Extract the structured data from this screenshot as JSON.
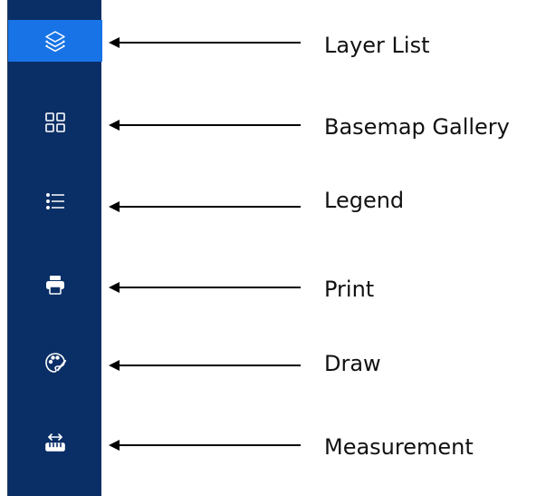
{
  "toolbar": {
    "accent_color": "#1874e6",
    "background_color": "#0a2f66",
    "tools": [
      {
        "icon": "layers-icon",
        "active": true
      },
      {
        "icon": "grid-icon",
        "active": false
      },
      {
        "icon": "list-icon",
        "active": false
      },
      {
        "icon": "printer-icon",
        "active": false
      },
      {
        "icon": "palette-icon",
        "active": false
      },
      {
        "icon": "ruler-icon",
        "active": false
      }
    ]
  },
  "callouts": {
    "layer_list": "Layer List",
    "basemap_gallery": "Basemap Gallery",
    "legend": "Legend",
    "print": "Print",
    "draw": "Draw",
    "measurement": "Measurement"
  }
}
